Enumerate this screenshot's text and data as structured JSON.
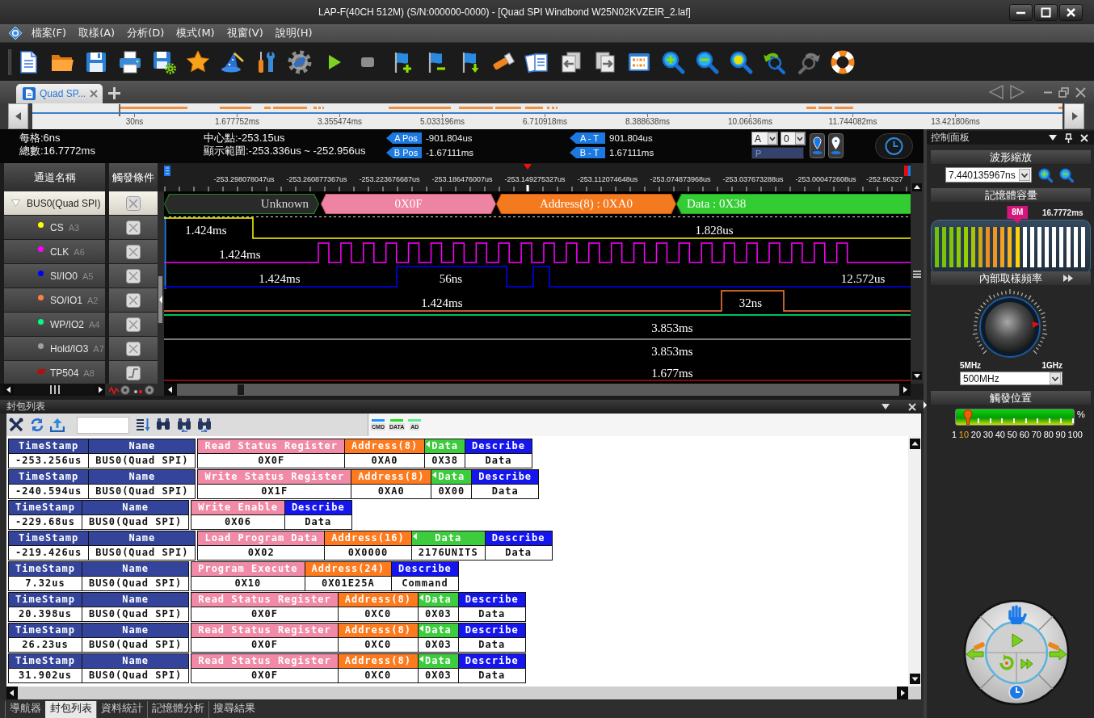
{
  "window": {
    "title": "LAP-F(40CH 512M) (S/N:000000-0000) - [Quad SPI Windbond W25N02KVZEIR_2.laf]"
  },
  "menu": [
    "檔案(F)",
    "取樣(A)",
    "分析(D)",
    "模式(M)",
    "視窗(V)",
    "說明(H)"
  ],
  "document_tabs": [
    {
      "label": "Quad SP...",
      "selected": true
    }
  ],
  "overview": {
    "ticks": [
      "30ns",
      "1.677752ms",
      "3.355474ms",
      "5.033196ms",
      "6.710918ms",
      "8.388638ms",
      "10.06636ms",
      "11.744082ms",
      "13.421806ms"
    ]
  },
  "info": {
    "per_division": "每格:6ns",
    "total": "總數:16.7772ms",
    "center": "中心點:-253.15us",
    "range": "顯示範圍:-253.336us ~ -252.956us"
  },
  "cursors": [
    {
      "label": "A Pos",
      "value": "-901.804us"
    },
    {
      "label": "B Pos",
      "value": "-1.67111ms"
    },
    {
      "label": "A - T",
      "value": "901.804us"
    },
    {
      "label": "B - T",
      "value": "1.67111ms"
    }
  ],
  "cursor_selectors": [
    "A",
    "0"
  ],
  "pattern_field": {
    "placeholder": "P"
  },
  "channels": {
    "name_header": "通道名稱",
    "trigger_header": "觸發條件",
    "timeline": [
      "-253.298078047us",
      "-253.260877367us",
      "-253.223676687us",
      "-253.186476007us",
      "-253.149275327us",
      "-253.112074648us",
      "-253.074873968us",
      "-253.037673288us",
      "-253.000472608us",
      "-252.96327"
    ],
    "rows": [
      {
        "kind": "bus",
        "name": "BUS0(Quad SPI)",
        "expanded": true,
        "selected": true,
        "edge_trigger": false,
        "segments": [
          {
            "kind": "unknown",
            "text": "Unknown"
          },
          {
            "kind": "command",
            "text": "0X0F"
          },
          {
            "kind": "address",
            "text": "Address(8) : 0XA0"
          },
          {
            "kind": "data",
            "text": "Data : 0X38"
          }
        ]
      },
      {
        "kind": "signal",
        "name": "CS",
        "pin": "A3",
        "color": "#ffff00",
        "selected": false,
        "edge_trigger": false,
        "labels": [
          "1.424ms",
          "1.828us"
        ]
      },
      {
        "kind": "signal",
        "name": "CLK",
        "pin": "A6",
        "color": "#ff00ff",
        "selected": false,
        "edge_trigger": false,
        "labels": [
          "1.424ms"
        ]
      },
      {
        "kind": "signal",
        "name": "SI/IO0",
        "pin": "A5",
        "color": "#0000ff",
        "selected": false,
        "edge_trigger": false,
        "labels": [
          "1.424ms",
          "56ns",
          "12.572us"
        ]
      },
      {
        "kind": "signal",
        "name": "SO/IO1",
        "pin": "A2",
        "color": "#ff7f3f",
        "selected": false,
        "edge_trigger": false,
        "labels": [
          "1.424ms",
          "32ns"
        ]
      },
      {
        "kind": "signal",
        "name": "WP/IO2",
        "pin": "A4",
        "color": "#00ff7f",
        "selected": false,
        "edge_trigger": false,
        "labels": [
          "3.853ms"
        ]
      },
      {
        "kind": "signal",
        "name": "Hold/IO3",
        "pin": "A7",
        "color": "#a0a0a0",
        "selected": false,
        "edge_trigger": false,
        "labels": [
          "3.853ms"
        ]
      },
      {
        "kind": "probe",
        "name": "TP504",
        "pin": "A8",
        "color": "#b01010",
        "selected": false,
        "edge_trigger": true,
        "labels": [
          "1.677ms"
        ]
      }
    ]
  },
  "packet_list": {
    "title": "封包列表",
    "legend": [
      {
        "label": "CMD",
        "color": "#1e90ff"
      },
      {
        "label": "DATA",
        "color": "#22dd22"
      },
      {
        "label": "AD",
        "color": "#55ee88"
      }
    ],
    "packets": [
      {
        "columns": [
          {
            "kind": "time",
            "header": "TimeStamp",
            "value": "-253.256us"
          },
          {
            "kind": "name",
            "header": "Name",
            "value": "BUS0(Quad SPI)"
          },
          {
            "kind": "command",
            "header": "Read Status Register",
            "value": "0X0F"
          },
          {
            "kind": "address",
            "header": "Address(8)",
            "value": "0XA0"
          },
          {
            "kind": "data",
            "header": "Data",
            "value": "0X38"
          },
          {
            "kind": "describe",
            "header": "Describe",
            "value": "Data"
          }
        ]
      },
      {
        "columns": [
          {
            "kind": "time",
            "header": "TimeStamp",
            "value": "-240.594us"
          },
          {
            "kind": "name",
            "header": "Name",
            "value": "BUS0(Quad SPI)"
          },
          {
            "kind": "command",
            "header": "Write Status Register",
            "value": "0X1F"
          },
          {
            "kind": "address",
            "header": "Address(8)",
            "value": "0XA0"
          },
          {
            "kind": "data",
            "header": "Data",
            "value": "0X00"
          },
          {
            "kind": "describe",
            "header": "Describe",
            "value": "Data"
          }
        ]
      },
      {
        "columns": [
          {
            "kind": "time",
            "header": "TimeStamp",
            "value": "-229.68us"
          },
          {
            "kind": "name",
            "header": "Name",
            "value": "BUS0(Quad SPI)"
          },
          {
            "kind": "command",
            "header": "Write Enable",
            "value": "0X06"
          },
          {
            "kind": "describe",
            "header": "Describe",
            "value": "Data"
          }
        ]
      },
      {
        "columns": [
          {
            "kind": "time",
            "header": "TimeStamp",
            "value": "-219.426us"
          },
          {
            "kind": "name",
            "header": "Name",
            "value": "BUS0(Quad SPI)"
          },
          {
            "kind": "command",
            "header": "Load Program Data",
            "value": "0X02"
          },
          {
            "kind": "address",
            "header": "Address(16)",
            "value": "0X0000"
          },
          {
            "kind": "data",
            "header": "Data",
            "value": "2176UNITS"
          },
          {
            "kind": "describe",
            "header": "Describe",
            "value": "Data"
          }
        ]
      },
      {
        "columns": [
          {
            "kind": "time",
            "header": "TimeStamp",
            "value": "7.32us"
          },
          {
            "kind": "name",
            "header": "Name",
            "value": "BUS0(Quad SPI)"
          },
          {
            "kind": "command",
            "header": "Program Execute",
            "value": "0X10"
          },
          {
            "kind": "address",
            "header": "Address(24)",
            "value": "0X01E25A"
          },
          {
            "kind": "describe",
            "header": "Describe",
            "value": "Command"
          }
        ]
      },
      {
        "columns": [
          {
            "kind": "time",
            "header": "TimeStamp",
            "value": "20.398us"
          },
          {
            "kind": "name",
            "header": "Name",
            "value": "BUS0(Quad SPI)"
          },
          {
            "kind": "command",
            "header": "Read Status Register",
            "value": "0X0F"
          },
          {
            "kind": "address",
            "header": "Address(8)",
            "value": "0XC0"
          },
          {
            "kind": "data",
            "header": "Data",
            "value": "0X03"
          },
          {
            "kind": "describe",
            "header": "Describe",
            "value": "Data"
          }
        ]
      },
      {
        "columns": [
          {
            "kind": "time",
            "header": "TimeStamp",
            "value": "26.23us"
          },
          {
            "kind": "name",
            "header": "Name",
            "value": "BUS0(Quad SPI)"
          },
          {
            "kind": "command",
            "header": "Read Status Register",
            "value": "0X0F"
          },
          {
            "kind": "address",
            "header": "Address(8)",
            "value": "0XC0"
          },
          {
            "kind": "data",
            "header": "Data",
            "value": "0X03"
          },
          {
            "kind": "describe",
            "header": "Describe",
            "value": "Data"
          }
        ]
      },
      {
        "columns": [
          {
            "kind": "time",
            "header": "TimeStamp",
            "value": "31.902us"
          },
          {
            "kind": "name",
            "header": "Name",
            "value": "BUS0(Quad SPI)"
          },
          {
            "kind": "command",
            "header": "Read Status Register",
            "value": "0X0F"
          },
          {
            "kind": "address",
            "header": "Address(8)",
            "value": "0XC0"
          },
          {
            "kind": "data",
            "header": "Data",
            "value": "0X03"
          },
          {
            "kind": "describe",
            "header": "Describe",
            "value": "Data"
          }
        ]
      }
    ]
  },
  "bottom_tabs": [
    {
      "label": "導航器",
      "selected": false
    },
    {
      "label": "封包列表",
      "selected": true
    },
    {
      "label": "資料統計",
      "selected": false
    },
    {
      "label": "記憶體分析",
      "selected": false
    },
    {
      "label": "搜尋結果",
      "selected": false
    }
  ],
  "control_panel": {
    "title": "控制面板",
    "zoom": {
      "title": "波形縮放",
      "value": "7.440135967ns"
    },
    "memory": {
      "title": "記憶體容量",
      "badge": "8M",
      "duration": "16.7772ms",
      "level": 0.57
    },
    "sample_rate": {
      "title": "內部取樣頻率",
      "level": 0.81,
      "min_label": "5MHz",
      "max_label": "1GHz",
      "value": "500MHz"
    },
    "trigger_position": {
      "title": "觸發位置",
      "level": 0.1,
      "unit": "%",
      "scale": [
        {
          "label": "1",
          "selected": false
        },
        {
          "label": "10",
          "selected": true
        },
        {
          "label": "20",
          "selected": false
        },
        {
          "label": "30",
          "selected": false
        },
        {
          "label": "40",
          "selected": false
        },
        {
          "label": "50",
          "selected": false
        },
        {
          "label": "60",
          "selected": false
        },
        {
          "label": "70",
          "selected": false
        },
        {
          "label": "80",
          "selected": false
        },
        {
          "label": "90",
          "selected": false
        },
        {
          "label": "100",
          "selected": false
        }
      ]
    }
  }
}
